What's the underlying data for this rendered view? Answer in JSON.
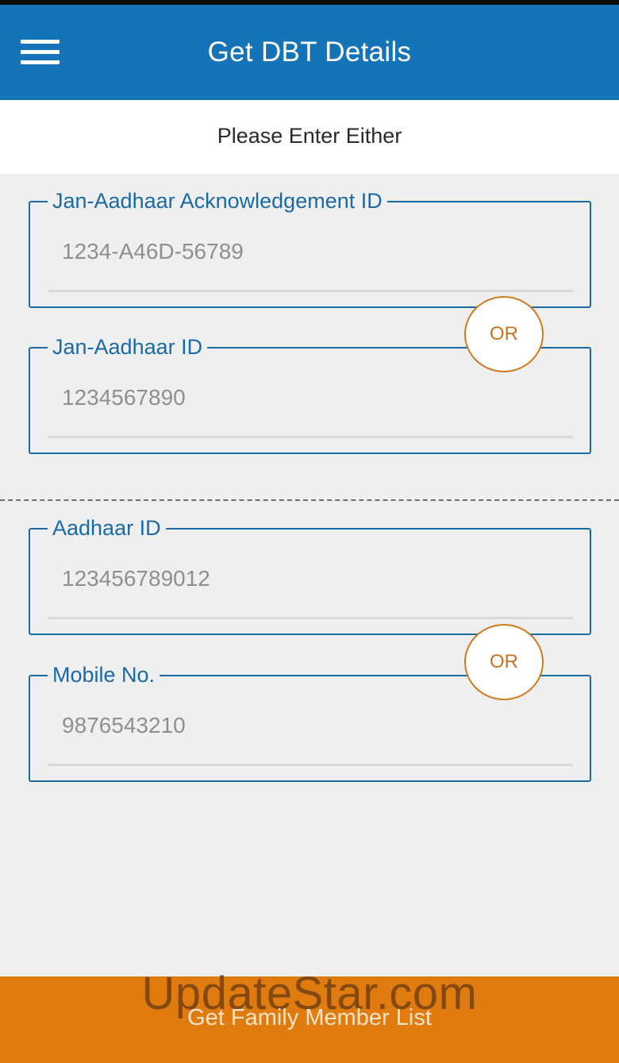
{
  "app_bar": {
    "title": "Get DBT Details",
    "color": "#1574b8"
  },
  "subheader": {
    "text": "Please Enter Either"
  },
  "fields": [
    {
      "label": "Jan-Aadhaar Acknowledgement ID",
      "value": "1234-A46D-56789"
    },
    {
      "label": "Jan-Aadhaar ID",
      "value": "1234567890"
    },
    {
      "label": "Aadhaar ID",
      "value": "123456789012"
    },
    {
      "label": "Mobile No.",
      "value": "9876543210"
    }
  ],
  "or_badges": [
    "OR",
    "OR"
  ],
  "bottom_bar": {
    "button_label": "Get Family Member List",
    "watermark": "UpdateStar.com",
    "color": "#e07b10"
  },
  "icons": {
    "menu": "hamburger-menu-icon"
  }
}
